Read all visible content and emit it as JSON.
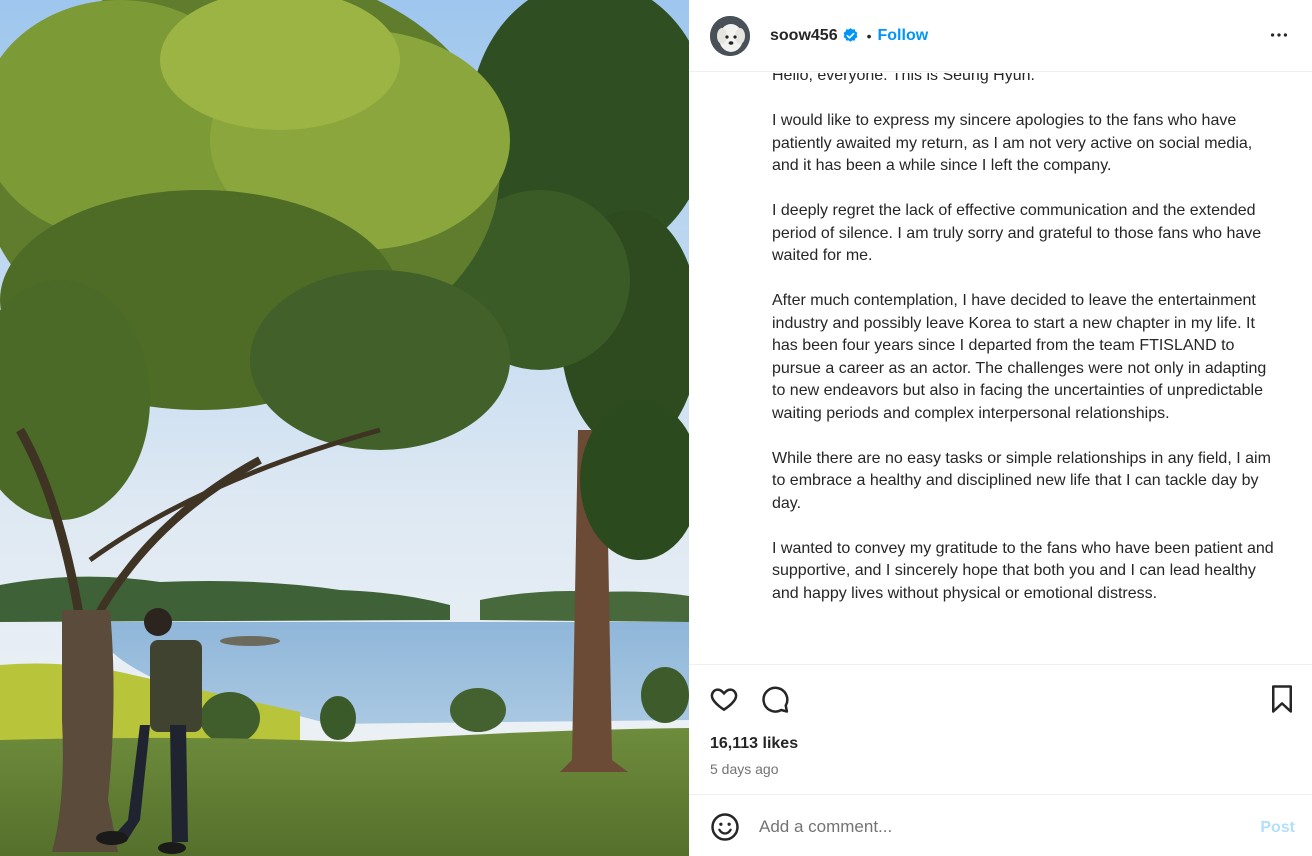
{
  "post": {
    "image_alt": "",
    "author": {
      "username": "soow456",
      "verified": true,
      "avatar_icon": "dog-avatar-icon"
    },
    "follow_label": "Follow",
    "separator": "•",
    "more_icon": "more-horizontal-icon",
    "caption_paragraphs": [
      "Hello, everyone. This is Seung Hyun.",
      "I would like to express my sincere apologies to the fans who have patiently awaited my return, as I am not very active on social media, and it has been a while since I left the company.",
      "I deeply regret the lack of effective communication and the extended period of silence. I am truly sorry and grateful to those fans who have waited for me.",
      "After much contemplation, I have decided to leave the entertainment industry and possibly leave Korea to start a new chapter in my life. It has been four years since I departed from the team FTISLAND to pursue a career as an actor. The challenges were not only in adapting to new endeavors but also in facing the uncertainties of unpredictable waiting periods and complex interpersonal relationships.",
      "While there are no easy tasks or simple relationships in any field, I aim to embrace a healthy and disciplined new life that I can tackle day by day.",
      "I wanted to convey my gratitude to the fans who have been patient and supportive, and I sincerely hope that both you and I can lead healthy and happy lives without physical or emotional distress."
    ],
    "likes": "16,113 likes",
    "time_ago": "5 days ago",
    "comment": {
      "placeholder": "Add a comment...",
      "post_label": "Post"
    }
  },
  "colors": {
    "accent": "#0095f6",
    "post_disabled": "#b2dffc",
    "text": "#262626",
    "muted": "#737373",
    "divider": "#efefef"
  }
}
